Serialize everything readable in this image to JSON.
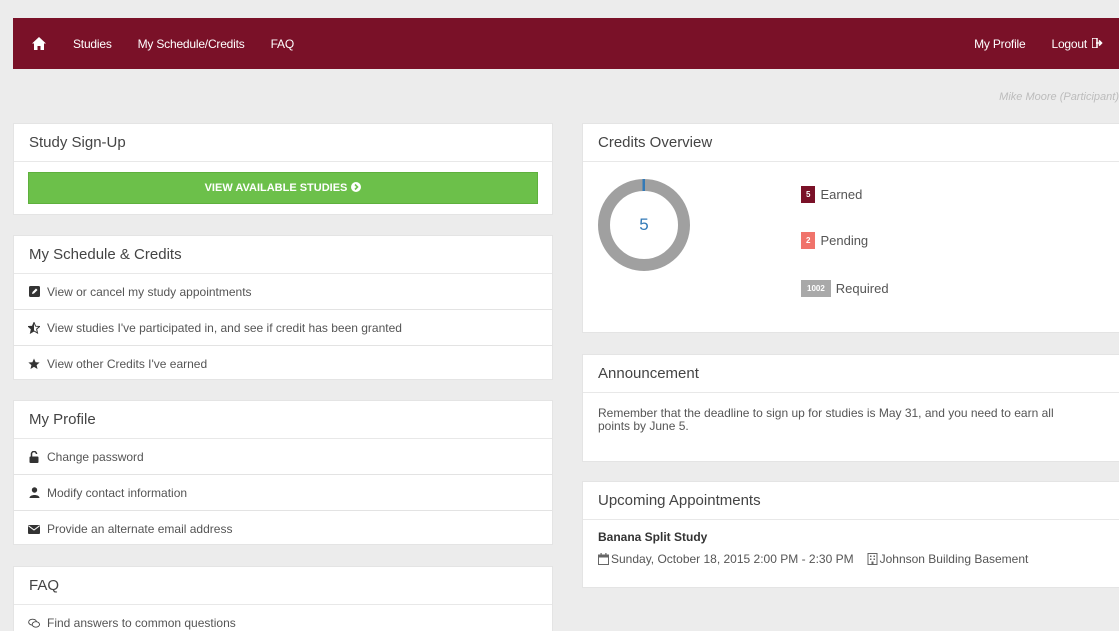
{
  "nav": {
    "home_icon": "home-icon",
    "links": [
      "Studies",
      "My Schedule/Credits",
      "FAQ"
    ],
    "profile": "My Profile",
    "logout": "Logout",
    "logout_icon": "sign-out-icon"
  },
  "user_label": "Mike Moore (Participant)",
  "study_signup": {
    "heading": "Study Sign-Up",
    "button": "VIEW AVAILABLE STUDIES",
    "button_icon": "chevron-circle-right-icon"
  },
  "schedule": {
    "heading": "My Schedule & Credits",
    "items": [
      {
        "icon": "edit-icon",
        "label": "View or cancel my study appointments"
      },
      {
        "icon": "star-half-icon",
        "label": "View studies I've participated in, and see if credit has been granted"
      },
      {
        "icon": "star-icon",
        "label": "View other Credits I've earned"
      }
    ]
  },
  "profile": {
    "heading": "My Profile",
    "items": [
      {
        "icon": "unlock-icon",
        "label": "Change password"
      },
      {
        "icon": "user-icon",
        "label": "Modify contact information"
      },
      {
        "icon": "envelope-icon",
        "label": "Provide an alternate email address"
      }
    ]
  },
  "faq": {
    "heading": "FAQ",
    "items": [
      {
        "icon": "comments-icon",
        "label": "Find answers to common questions"
      }
    ]
  },
  "credits": {
    "heading": "Credits Overview",
    "center_value": "5",
    "earned": {
      "count": "5",
      "label": "Earned",
      "color": "#7a1128"
    },
    "pending": {
      "count": "2",
      "label": "Pending",
      "color": "#f0736b"
    },
    "required": {
      "count": "1002",
      "label": "Required",
      "color": "#a9a9a9"
    },
    "ring_color": "#a0a0a0",
    "ring_accent": "#337ab7"
  },
  "announcement": {
    "heading": "Announcement",
    "text": "Remember that the deadline to sign up for studies is May 31, and you need to earn all points by June 5."
  },
  "appointments": {
    "heading": "Upcoming Appointments",
    "items": [
      {
        "title": "Banana Split Study",
        "date": "Sunday, October 18, 2015 2:00 PM - 2:30 PM",
        "date_icon": "calendar-icon",
        "location": "Johnson Building Basement",
        "location_icon": "building-icon"
      }
    ]
  },
  "colors": {
    "navbar": "#7a1128",
    "button_green": "#6cc04a",
    "background": "#ececec"
  }
}
